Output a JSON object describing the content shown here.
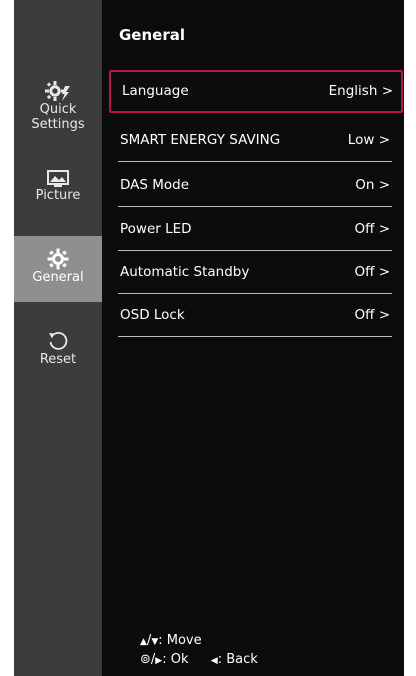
{
  "sidebar": {
    "items": [
      {
        "label": "Quick\nSettings",
        "line1": "Quick",
        "line2": "Settings",
        "icon": "quick-settings-icon",
        "active": false
      },
      {
        "label": "Picture",
        "icon": "picture-icon",
        "active": false
      },
      {
        "label": "General",
        "icon": "gear-icon",
        "active": true
      },
      {
        "label": "Reset",
        "icon": "reset-icon",
        "active": false
      }
    ]
  },
  "main": {
    "title": "General",
    "rows": [
      {
        "label": "Language",
        "value": "English",
        "selected": true
      },
      {
        "label": "SMART ENERGY SAVING",
        "value": "Low",
        "selected": false
      },
      {
        "label": "DAS Mode",
        "value": "On",
        "selected": false
      },
      {
        "label": "Power LED",
        "value": "Off",
        "selected": false
      },
      {
        "label": "Automatic Standby",
        "value": "Off",
        "selected": false
      },
      {
        "label": "OSD Lock",
        "value": "Off",
        "selected": false
      }
    ],
    "chevron": ">"
  },
  "footer": {
    "move_label": ": Move",
    "ok_label": ": Ok",
    "back_label": ": Back"
  },
  "colors": {
    "background": "#0c0c0c",
    "sidebar": "#3c3c3c",
    "sidebar_active": "#8f8f8f",
    "selection_border": "#b5174a",
    "divider": "#bdbdbd"
  }
}
